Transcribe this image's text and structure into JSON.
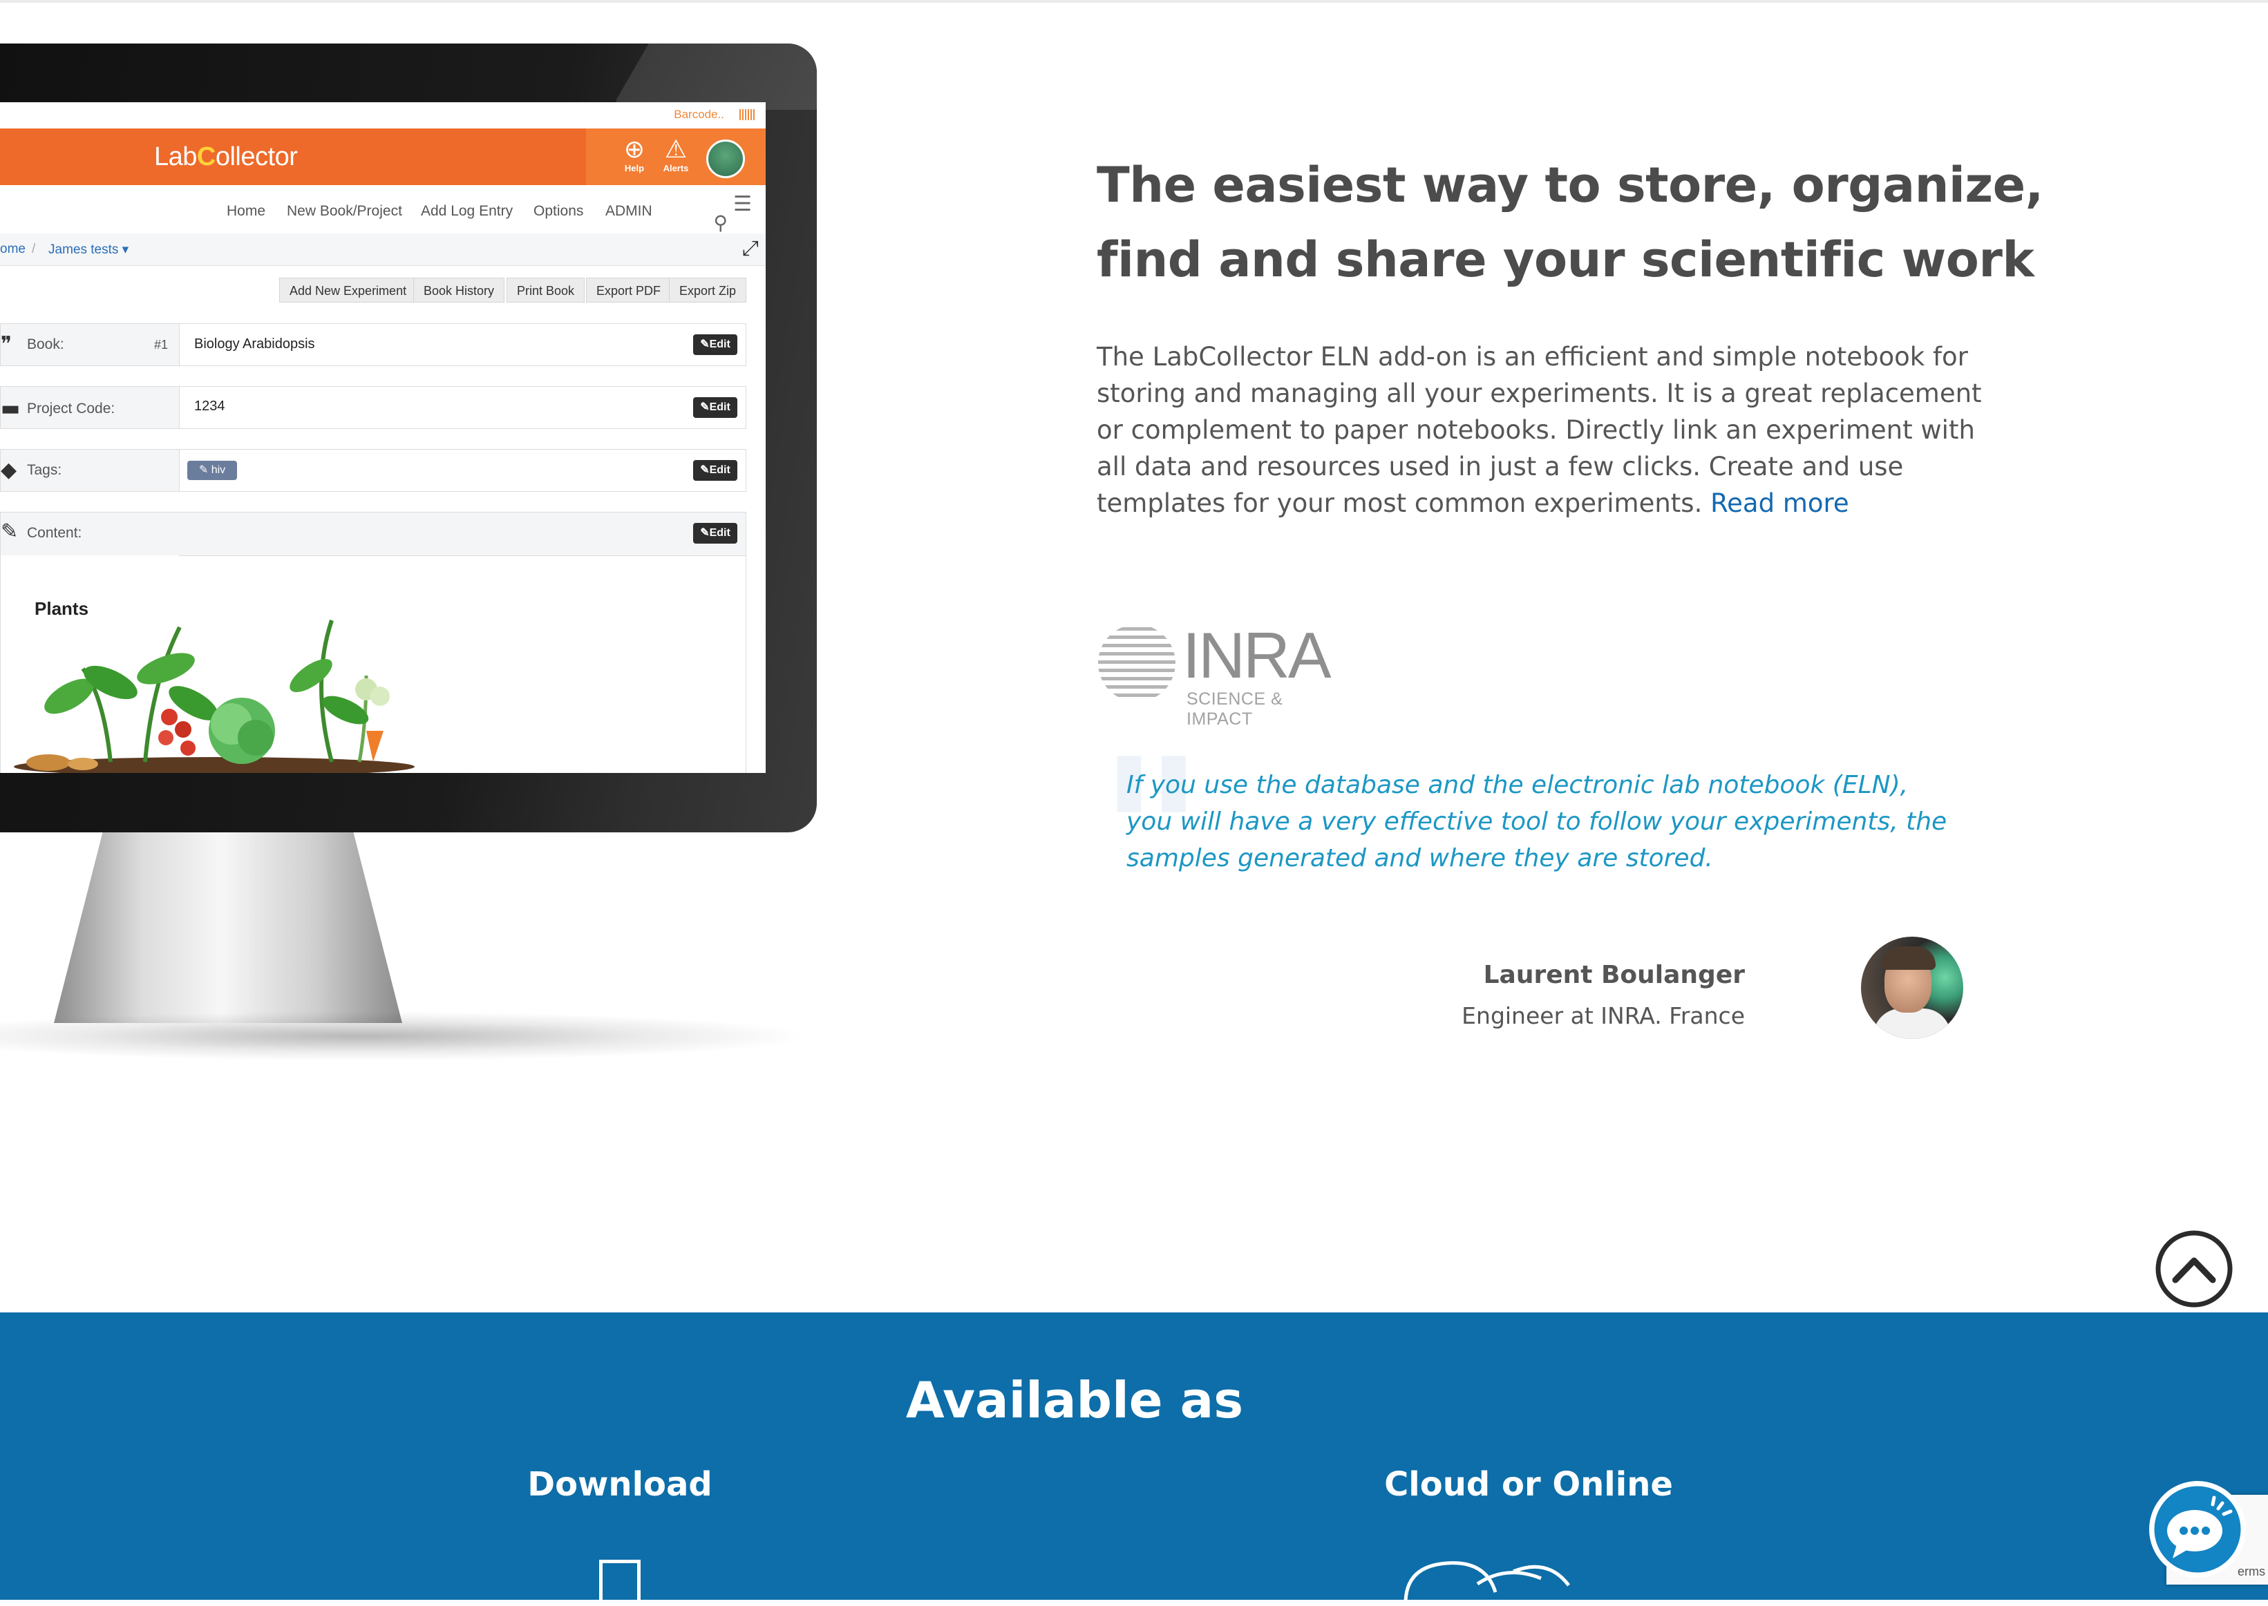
{
  "app": {
    "barcode_link": "Barcode..",
    "logo_left": "Lab",
    "logo_c": "C",
    "logo_right": "ollector",
    "help_label": "Help",
    "alerts_label": "Alerts",
    "nav": [
      "Home",
      "New Book/Project",
      "Add Log Entry",
      "Options",
      "ADMIN"
    ],
    "breadcrumb": {
      "home": "ome",
      "separator": "/",
      "current": "James tests ▾"
    },
    "actions": [
      "Add New Experiment",
      "Book History",
      "Print Book",
      "Export PDF",
      "Export Zip"
    ],
    "fields": {
      "book": {
        "label": "Book:",
        "number": "#1",
        "value": "Biology Arabidopsis"
      },
      "project": {
        "label": "Project Code:",
        "value": "1234"
      },
      "tags": {
        "label": "Tags:",
        "tag": "✎ hiv"
      },
      "content": {
        "label": "Content:"
      }
    },
    "edit_label": "✎Edit",
    "plants_title": "Plants"
  },
  "hero": {
    "headline_line1": "The easiest way to store, organize,",
    "headline_line2": "find and share your scientific work",
    "description": "The LabCollector ELN add-on is an efficient and simple notebook for storing and managing all your experiments. It is a great replacement or complement to paper notebooks.  Directly link an experiment with all data and resources used in just a few clicks. Create and use templates for your most common experiments. ",
    "read_more": "Read more"
  },
  "testimonial": {
    "logo_word": "INRA",
    "logo_sub": "SCIENCE & IMPACT",
    "quote": "If you use the database and the electronic lab notebook (ELN), you will have a very effective tool to follow your experiments, the samples generated and where they are stored.",
    "author": "Laurent Boulanger",
    "role": "Engineer at INRA. France"
  },
  "available": {
    "title": "Available as",
    "download": "Download",
    "cloud": "Cloud or Online"
  },
  "recaptcha_text": "erms",
  "colors": {
    "accent_orange": "#ee6a2a",
    "brand_blue": "#0d6ea9",
    "quote_teal": "#1c97c4",
    "link_blue": "#1369b1"
  },
  "icons": [
    "scroll-to-top-icon",
    "chat-icon",
    "download-icon",
    "cloud-icon",
    "help-icon",
    "alerts-icon",
    "search-icon",
    "list-icon",
    "expand-icon"
  ]
}
